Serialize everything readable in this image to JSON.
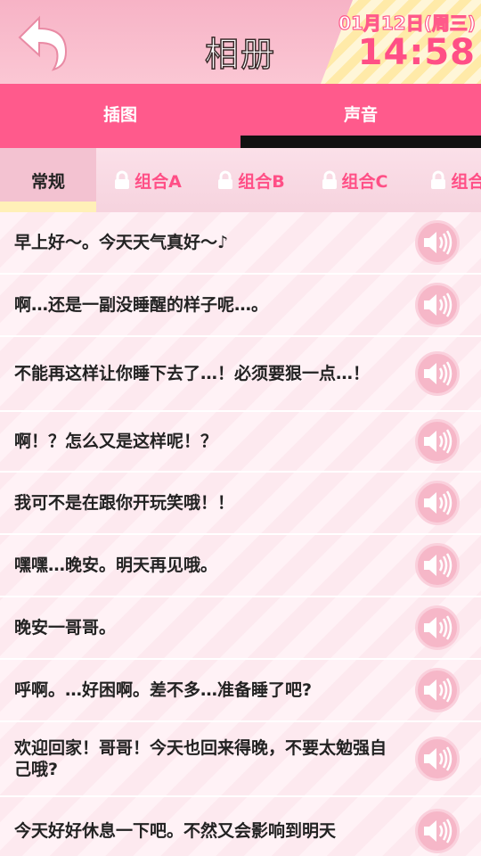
{
  "header": {
    "title": "相册",
    "date": "01月12日(周三)",
    "time": "14:58"
  },
  "main_tabs": [
    {
      "label": "插图",
      "active": false
    },
    {
      "label": "声音",
      "active": true
    }
  ],
  "sub_tabs": [
    {
      "label": "常规",
      "locked": false,
      "active": true
    },
    {
      "label": "组合A",
      "locked": true
    },
    {
      "label": "组合B",
      "locked": true
    },
    {
      "label": "组合C",
      "locked": true
    },
    {
      "label": "组合",
      "locked": true
    }
  ],
  "voice_lines": [
    "早上好～。今天天气真好～♪",
    "啊…还是一副没睡醒的样子呢…。",
    "不能再这样让你睡下去了…！必须要狠一点…！",
    "啊！？怎么又是这样呢！？",
    "我可不是在跟你开玩笑哦！！",
    "嘿嘿…晚安。明天再见哦。",
    "晚安一哥哥。",
    "呼啊。…好困啊。差不多…准备睡了吧?",
    "欢迎回家！哥哥！今天也回来得晚，不要太勉强自己哦?",
    "今天好好休息一下吧。不然又会影响到明天"
  ],
  "colors": {
    "accent": "#ff5a8c",
    "tab_underline": "#111111",
    "locked_text": "#ff4f86"
  }
}
